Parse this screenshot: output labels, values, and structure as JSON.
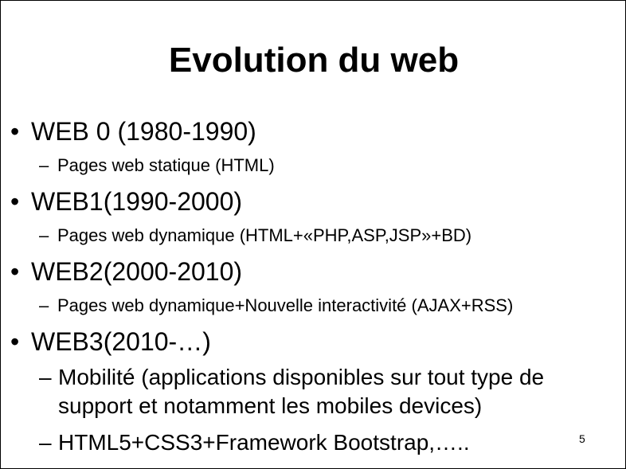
{
  "slide": {
    "title": "Evolution du web",
    "page_number": "5",
    "bullet_char": "•",
    "dash_char": "–",
    "items": [
      {
        "label": "WEB 0 (1980-1990)",
        "sub": [
          "Pages web statique (HTML)"
        ]
      },
      {
        "label": "WEB1(1990-2000)",
        "sub": [
          "Pages web dynamique (HTML+«PHP,ASP,JSP»+BD)"
        ]
      },
      {
        "label": "WEB2(2000-2010)",
        "sub": [
          "Pages web dynamique+Nouvelle interactivité (AJAX+RSS)"
        ]
      },
      {
        "label": "WEB3(2010-…)",
        "sub": [
          "Mobilité (applications disponibles sur tout type de support et notamment les mobiles devices)",
          "HTML5+CSS3+Framework Bootstrap,….."
        ]
      }
    ]
  }
}
